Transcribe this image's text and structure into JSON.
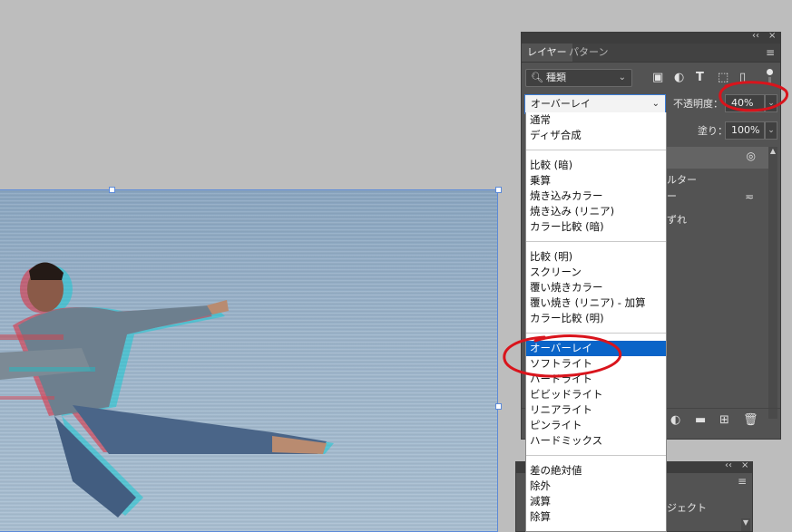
{
  "panel": {
    "tabs": [
      "レイヤー",
      "パターン"
    ],
    "collapse_glyph": "‹‹",
    "close_glyph": "×",
    "menu_glyph": "≡",
    "filter": {
      "kind_label": "種類",
      "icons": [
        "image-filter-icon",
        "adjustment-filter-icon",
        "type-filter-icon",
        "shape-filter-icon",
        "smart-object-filter-icon"
      ]
    },
    "blend_mode": "オーバーレイ",
    "opacity_label": "不透明度：",
    "opacity_value": "40%",
    "fill_label": "塗り：",
    "fill_value": "100%",
    "visible_layer_text": [
      "ルター",
      "ー",
      "ずれ"
    ]
  },
  "dropdown": {
    "groups": [
      [
        "通常",
        "ディザ合成"
      ],
      [
        "比較 (暗)",
        "乗算",
        "焼き込みカラー",
        "焼き込み (リニア)",
        "カラー比較 (暗)"
      ],
      [
        "比較 (明)",
        "スクリーン",
        "覆い焼きカラー",
        "覆い焼き (リニア) - 加算",
        "カラー比較 (明)"
      ],
      [
        "オーバーレイ",
        "ソフトライト",
        "ハードライト",
        "ビビッドライト",
        "リニアライト",
        "ピンライト",
        "ハードミックス"
      ],
      [
        "差の絶対値",
        "除外",
        "減算",
        "除算"
      ]
    ],
    "selected": "オーバーレイ"
  },
  "panel2": {
    "partial_text": "ジェクト"
  },
  "colors": {
    "canvas_bg": "#bdbdbd",
    "panel_bg": "#535353",
    "selection_blue": "#0a64c8",
    "annotation_red": "#d9141c"
  }
}
